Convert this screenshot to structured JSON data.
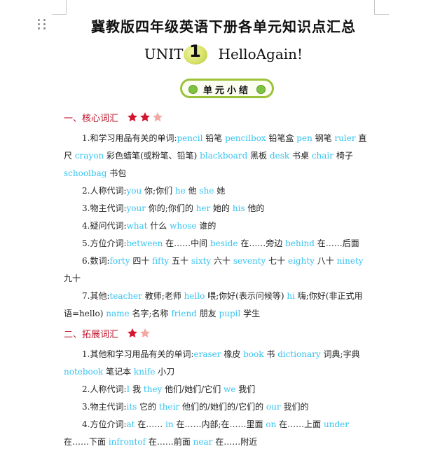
{
  "doc": {
    "title": "冀教版四年级英语下册各单元知识点汇总",
    "unit": {
      "prefix": "UNIT",
      "number": "1",
      "name": "HelloAgain!"
    },
    "summary_label": "单元小结",
    "section1": {
      "heading": "一、核心词汇",
      "stars": 2.5,
      "items": [
        {
          "lines": [
            [
              {
                "t": "1.和学习用品有关的单词:"
              },
              {
                "t": "pencil",
                "en": true
              },
              {
                "t": " 铅笔  "
              },
              {
                "t": "pencilbox",
                "en": true
              },
              {
                "t": " 铅笔盒  "
              },
              {
                "t": "pen",
                "en": true
              },
              {
                "t": " 钢笔  "
              },
              {
                "t": "ruler",
                "en": true
              },
              {
                "t": " 直"
              }
            ],
            [
              {
                "t": "尺  "
              },
              {
                "t": "crayon",
                "en": true
              },
              {
                "t": " 彩色蜡笔(或粉笔、铅笔)  "
              },
              {
                "t": "blackboard",
                "en": true
              },
              {
                "t": " 黑板  "
              },
              {
                "t": "desk",
                "en": true
              },
              {
                "t": " 书桌  "
              },
              {
                "t": "chair",
                "en": true
              },
              {
                "t": " 椅子"
              }
            ],
            [
              {
                "t": "schoolbag",
                "en": true
              },
              {
                "t": " 书包"
              }
            ]
          ]
        },
        {
          "lines": [
            [
              {
                "t": "2.人称代词:"
              },
              {
                "t": "you",
                "en": true
              },
              {
                "t": " 你;你们  "
              },
              {
                "t": "he",
                "en": true
              },
              {
                "t": " 他  "
              },
              {
                "t": "she",
                "en": true
              },
              {
                "t": " 她"
              }
            ]
          ]
        },
        {
          "lines": [
            [
              {
                "t": "3.物主代词:"
              },
              {
                "t": "your",
                "en": true
              },
              {
                "t": " 你的;你们的  "
              },
              {
                "t": "her",
                "en": true
              },
              {
                "t": " 她的  "
              },
              {
                "t": "his",
                "en": true
              },
              {
                "t": " 他的"
              }
            ]
          ]
        },
        {
          "lines": [
            [
              {
                "t": "4.疑问代词:"
              },
              {
                "t": "what",
                "en": true
              },
              {
                "t": " 什么  "
              },
              {
                "t": "whose",
                "en": true
              },
              {
                "t": " 谁的"
              }
            ]
          ]
        },
        {
          "lines": [
            [
              {
                "t": "5.方位介词:"
              },
              {
                "t": "between",
                "en": true
              },
              {
                "t": " 在……中间  "
              },
              {
                "t": "beside",
                "en": true
              },
              {
                "t": " 在……旁边  "
              },
              {
                "t": "behind",
                "en": true
              },
              {
                "t": " 在……后面"
              }
            ]
          ]
        },
        {
          "lines": [
            [
              {
                "t": "6.数词:"
              },
              {
                "t": "forty",
                "en": true
              },
              {
                "t": " 四十  "
              },
              {
                "t": "fifty",
                "en": true
              },
              {
                "t": " 五十  "
              },
              {
                "t": "sixty",
                "en": true
              },
              {
                "t": " 六十  "
              },
              {
                "t": "seventy",
                "en": true
              },
              {
                "t": " 七十  "
              },
              {
                "t": "eighty",
                "en": true
              },
              {
                "t": " 八十  "
              },
              {
                "t": "ninety",
                "en": true
              }
            ],
            [
              {
                "t": "九十"
              }
            ]
          ]
        },
        {
          "lines": [
            [
              {
                "t": "7.其他:"
              },
              {
                "t": "teacher",
                "en": true
              },
              {
                "t": " 教师;老师  "
              },
              {
                "t": "hello",
                "en": true
              },
              {
                "t": " 喂;你好(表示问候等)  "
              },
              {
                "t": "hi",
                "en": true
              },
              {
                "t": " 嗨;你好(非正式用"
              }
            ],
            [
              {
                "t": "语=hello)  "
              },
              {
                "t": "name",
                "en": true
              },
              {
                "t": " 名字;名称  "
              },
              {
                "t": "friend",
                "en": true
              },
              {
                "t": " 朋友  "
              },
              {
                "t": "pupil",
                "en": true
              },
              {
                "t": " 学生"
              }
            ]
          ]
        }
      ]
    },
    "section2": {
      "heading": "二、拓展词汇",
      "stars": 1.5,
      "items": [
        {
          "lines": [
            [
              {
                "t": "1.其他和学习用品有关的单词:"
              },
              {
                "t": "eraser",
                "en": true
              },
              {
                "t": " 橡皮  "
              },
              {
                "t": "book",
                "en": true
              },
              {
                "t": " 书  "
              },
              {
                "t": "dictionary",
                "en": true
              },
              {
                "t": " 词典;字典"
              }
            ],
            [
              {
                "t": "notebook",
                "en": true
              },
              {
                "t": " 笔记本  "
              },
              {
                "t": "knife",
                "en": true
              },
              {
                "t": " 小刀"
              }
            ]
          ]
        },
        {
          "lines": [
            [
              {
                "t": "2.人称代词:"
              },
              {
                "t": "I",
                "en": true
              },
              {
                "t": " 我  "
              },
              {
                "t": "they",
                "en": true
              },
              {
                "t": " 他们/她们/它们  "
              },
              {
                "t": "we",
                "en": true
              },
              {
                "t": " 我们"
              }
            ]
          ]
        },
        {
          "lines": [
            [
              {
                "t": "3.物主代词:"
              },
              {
                "t": "its",
                "en": true
              },
              {
                "t": " 它的  "
              },
              {
                "t": "their",
                "en": true
              },
              {
                "t": " 他们的/她们的/它们的  "
              },
              {
                "t": "our",
                "en": true
              },
              {
                "t": " 我们的"
              }
            ]
          ]
        },
        {
          "lines": [
            [
              {
                "t": "4.方位介词:"
              },
              {
                "t": "at",
                "en": true
              },
              {
                "t": " 在……  "
              },
              {
                "t": "in",
                "en": true
              },
              {
                "t": " 在……内部;在……里面  "
              },
              {
                "t": "on",
                "en": true
              },
              {
                "t": " 在……上面  "
              },
              {
                "t": "under",
                "en": true
              }
            ],
            [
              {
                "t": "在……下面  "
              },
              {
                "t": "infrontof",
                "en": true
              },
              {
                "t": " 在……前面  "
              },
              {
                "t": "near",
                "en": true
              },
              {
                "t": " 在……附近"
              }
            ]
          ]
        }
      ]
    }
  }
}
